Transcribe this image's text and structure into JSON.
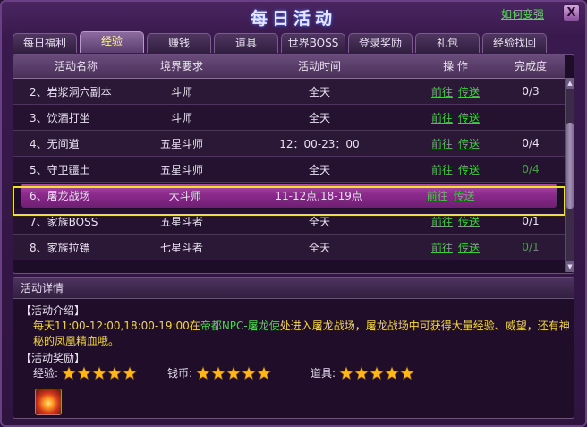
{
  "window": {
    "title": "每日活动",
    "howto_label": "如何变强",
    "close_label": "X"
  },
  "tabs": [
    {
      "label": "每日福利",
      "active": false
    },
    {
      "label": "经验",
      "active": true
    },
    {
      "label": "赚钱",
      "active": false
    },
    {
      "label": "道具",
      "active": false
    },
    {
      "label": "世界BOSS",
      "active": false
    },
    {
      "label": "登录奖励",
      "active": false
    },
    {
      "label": "礼包",
      "active": false
    },
    {
      "label": "经验找回",
      "active": false
    }
  ],
  "table": {
    "headers": {
      "name": "活动名称",
      "requirement": "境界要求",
      "time": "活动时间",
      "op": "操 作",
      "done": "完成度"
    },
    "rows": [
      {
        "name": "2、岩浆洞穴副本",
        "req": "斗师",
        "time": "全天",
        "go": "前往",
        "teleport": "传送",
        "done": "0/3"
      },
      {
        "name": "3、饮酒打坐",
        "req": "斗师",
        "time": "全天",
        "go": "前往",
        "teleport": "传送",
        "done": ""
      },
      {
        "name": "4、无间道",
        "req": "五星斗师",
        "time": "12：00-23：00",
        "go": "前往",
        "teleport": "传送",
        "done": "0/4"
      },
      {
        "name": "5、守卫疆土",
        "req": "五星斗师",
        "time": "全天",
        "go": "前往",
        "teleport": "传送",
        "done": "0/4"
      },
      {
        "name": "6、屠龙战场",
        "req": "大斗师",
        "time": "11-12点,18-19点",
        "go": "前往",
        "teleport": "传送",
        "done": ""
      },
      {
        "name": "7、家族BOSS",
        "req": "五星斗者",
        "time": "全天",
        "go": "前往",
        "teleport": "传送",
        "done": "0/1"
      },
      {
        "name": "8、家族拉镖",
        "req": "七星斗者",
        "time": "全天",
        "go": "前往",
        "teleport": "传送",
        "done": "0/1"
      }
    ]
  },
  "detail": {
    "header": "活动详情",
    "intro_title": "【活动介绍】",
    "desc_part1": "每天11:00-12:00,18:00-19:00在",
    "desc_npc": "帝都NPC-屠龙使",
    "desc_part2": "处进入屠龙战场，屠龙战场中可获得大量经验、威望，还有神秘的凤凰精血哦。",
    "reward_title": "【活动奖励】",
    "rewards": [
      {
        "label": "经验:",
        "stars": 5
      },
      {
        "label": "钱币:",
        "stars": 5
      },
      {
        "label": "道具:",
        "stars": 5
      }
    ],
    "item_icon": "phoenix-blood-icon"
  },
  "colors": {
    "link_green": "#38d238",
    "highlight_yellow": "#f0e227",
    "star_gold": "#ffb619",
    "desc_yellow": "#f2d540"
  }
}
